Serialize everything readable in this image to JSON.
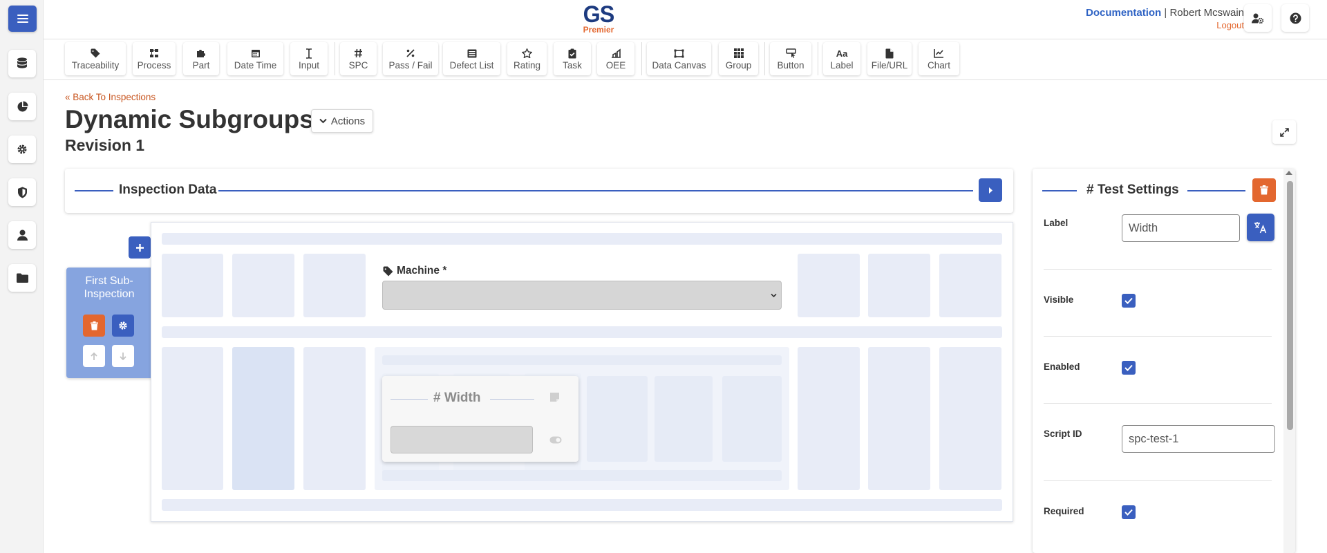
{
  "header": {
    "logo_main": "GS",
    "logo_sub": "Premier",
    "documentation_link": "Documentation",
    "separator": "|",
    "user_name": "Robert Mcswain",
    "logout": "Logout"
  },
  "sidebar": {
    "items": [
      {
        "icon": "database-icon"
      },
      {
        "icon": "pie-chart-icon"
      },
      {
        "icon": "gear-icon"
      },
      {
        "icon": "shield-icon"
      },
      {
        "icon": "user-icon"
      },
      {
        "icon": "folder-icon"
      }
    ]
  },
  "toolbar": {
    "items": [
      {
        "label": "Traceability",
        "icon": "tag-icon"
      },
      {
        "label": "Process",
        "icon": "process-icon"
      },
      {
        "label": "Part",
        "icon": "puzzle-icon"
      },
      {
        "label": "Date Time",
        "icon": "calendar-icon"
      },
      {
        "label": "Input",
        "icon": "text-cursor-icon"
      },
      {
        "label": "SPC",
        "icon": "hash-icon"
      },
      {
        "label": "Pass / Fail",
        "icon": "percent-icon"
      },
      {
        "label": "Defect List",
        "icon": "list-icon"
      },
      {
        "label": "Rating",
        "icon": "star-icon"
      },
      {
        "label": "Task",
        "icon": "clipboard-check-icon"
      },
      {
        "label": "OEE",
        "icon": "oee-icon"
      },
      {
        "label": "Data Canvas",
        "icon": "canvas-icon"
      },
      {
        "label": "Group",
        "icon": "grid-icon"
      },
      {
        "label": "Button",
        "icon": "button-icon"
      },
      {
        "label": "Label",
        "icon": "label-icon",
        "glyph": "Aa"
      },
      {
        "label": "File/URL",
        "icon": "file-icon"
      },
      {
        "label": "Chart",
        "icon": "chart-icon"
      }
    ]
  },
  "page": {
    "back_link": "Back To Inspections",
    "title": "Dynamic Subgroups",
    "actions_label": "Actions",
    "revision": "Revision 1"
  },
  "inspection": {
    "section_title": "Inspection Data",
    "subgroup_title": "First Sub-Inspection",
    "machine_label": "Machine *",
    "width_title": "# Width"
  },
  "settings": {
    "title": "Test Settings",
    "title_icon": "#",
    "label_field_label": "Label",
    "label_value": "Width",
    "visible_label": "Visible",
    "visible_checked": true,
    "enabled_label": "Enabled",
    "enabled_checked": true,
    "script_id_label": "Script ID",
    "script_id_value": "spc-test-1",
    "required_label": "Required",
    "required_checked": true
  },
  "colors": {
    "primary": "#3a5fbf",
    "danger": "#e3672f",
    "subgroup_bg": "#86a4df",
    "placeholder": "#e8ecf7"
  }
}
